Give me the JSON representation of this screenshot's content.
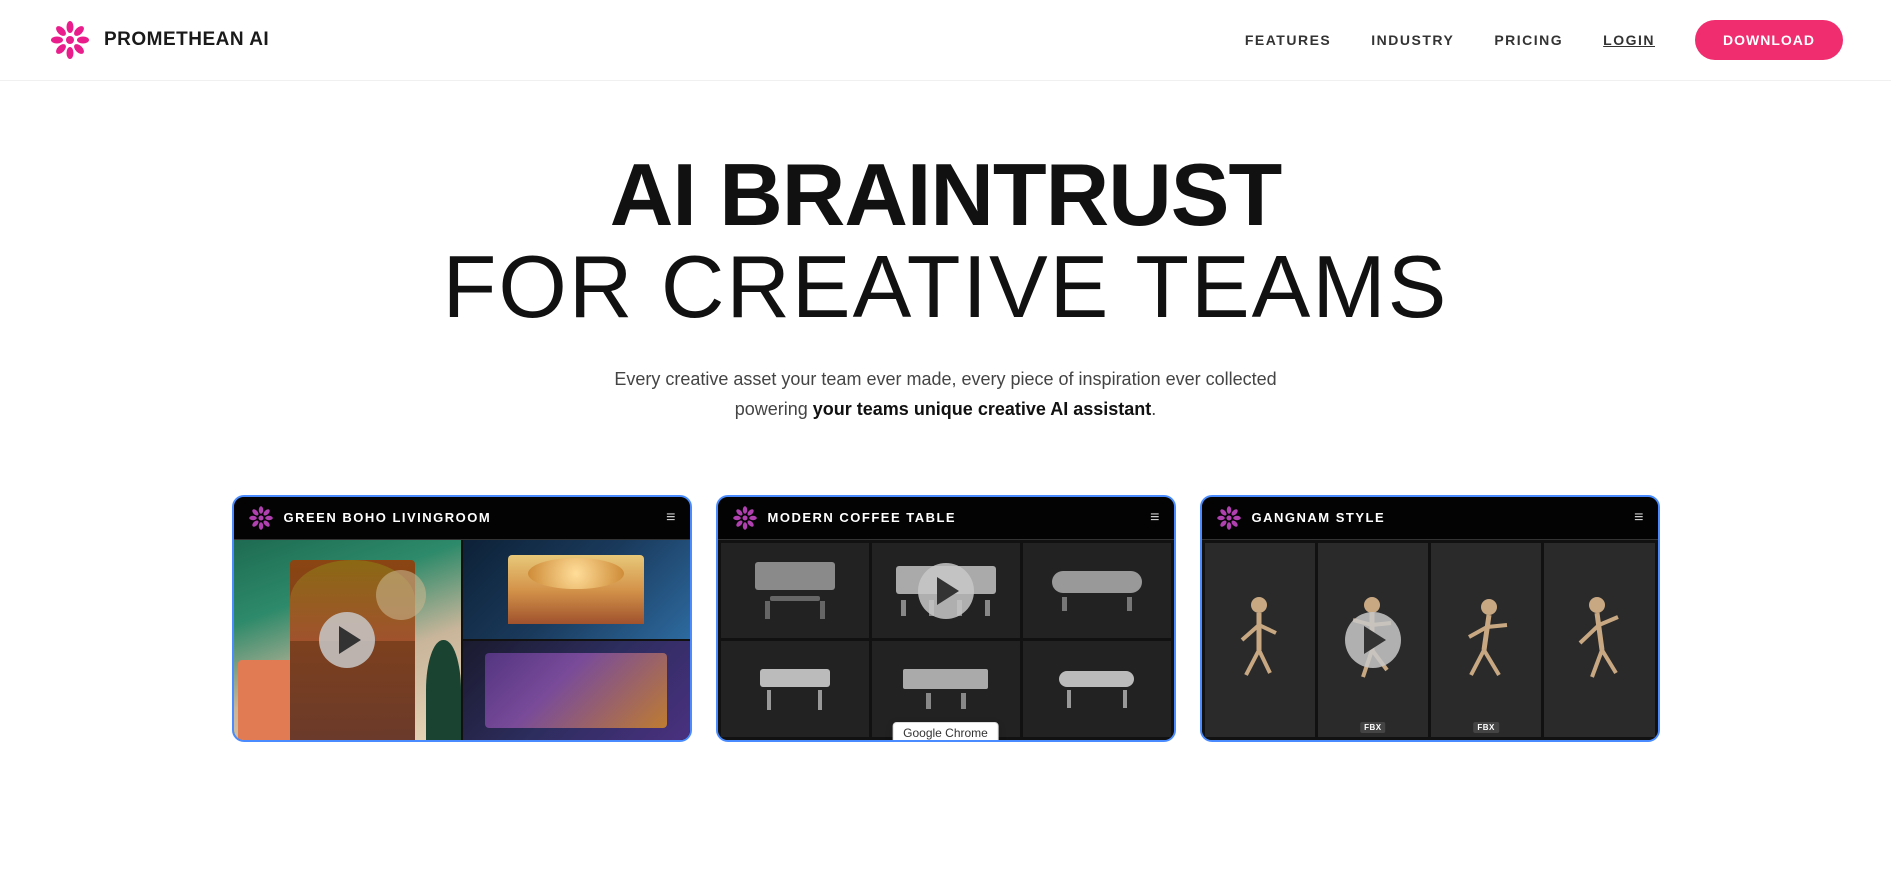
{
  "nav": {
    "logo_text": "PROMETHEAN AI",
    "links": [
      {
        "id": "features",
        "label": "FEATURES"
      },
      {
        "id": "industry",
        "label": "INDUSTRY"
      },
      {
        "id": "pricing",
        "label": "PRICING"
      },
      {
        "id": "login",
        "label": "LOGIN"
      }
    ],
    "download_label": "DOWNLOAD"
  },
  "hero": {
    "title_bold": "AI BRAINTRUST",
    "title_light": "FOR CREATIVE TEAMS",
    "subtitle_plain": "Every creative asset your team ever made, every piece of inspiration ever collected",
    "subtitle_bold": "powering your teams unique creative AI assistant",
    "subtitle_end": "."
  },
  "cards": [
    {
      "id": "card-1",
      "title": "GREEN BOHO LIVINGROOM",
      "border_color": "#4a8cff",
      "has_play": true,
      "type": "collage"
    },
    {
      "id": "card-2",
      "title": "MODERN COFFEE TABLE",
      "border_color": "#4a8cff",
      "has_play": true,
      "type": "grid",
      "chrome_tooltip": "Google Chrome"
    },
    {
      "id": "card-3",
      "title": "GANGNAM STYLE",
      "border_color": "#4a8cff",
      "has_play": true,
      "type": "frames"
    }
  ],
  "icons": {
    "promethean_color": "#e91e8c",
    "hamburger": "≡",
    "play": "▶"
  }
}
